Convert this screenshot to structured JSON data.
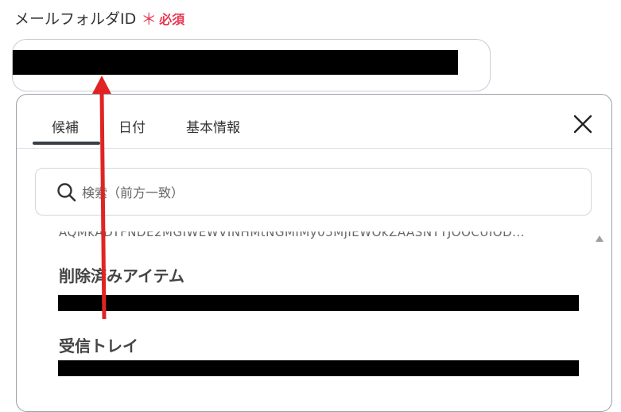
{
  "field": {
    "label": "メールフォルダID",
    "required_mark": "＊",
    "required_text": "必須"
  },
  "tabs": [
    {
      "label": "候補",
      "active": true
    },
    {
      "label": "日付",
      "active": false
    },
    {
      "label": "基本情報",
      "active": false
    }
  ],
  "search": {
    "placeholder": "検索（前方一致）"
  },
  "list": {
    "truncated_id": "AQMkADYFNDE2MGIWEWVINHMtNGMIMy05MjIEWOkZAASNTYJOOCUIOD...",
    "items": [
      {
        "name": "削除済みアイテム"
      },
      {
        "name": "受信トレイ"
      }
    ]
  },
  "colors": {
    "required": "#e8384f",
    "annotation_arrow": "#e02424"
  },
  "icons": [
    "close-icon",
    "search-icon",
    "scroll-up-icon"
  ]
}
